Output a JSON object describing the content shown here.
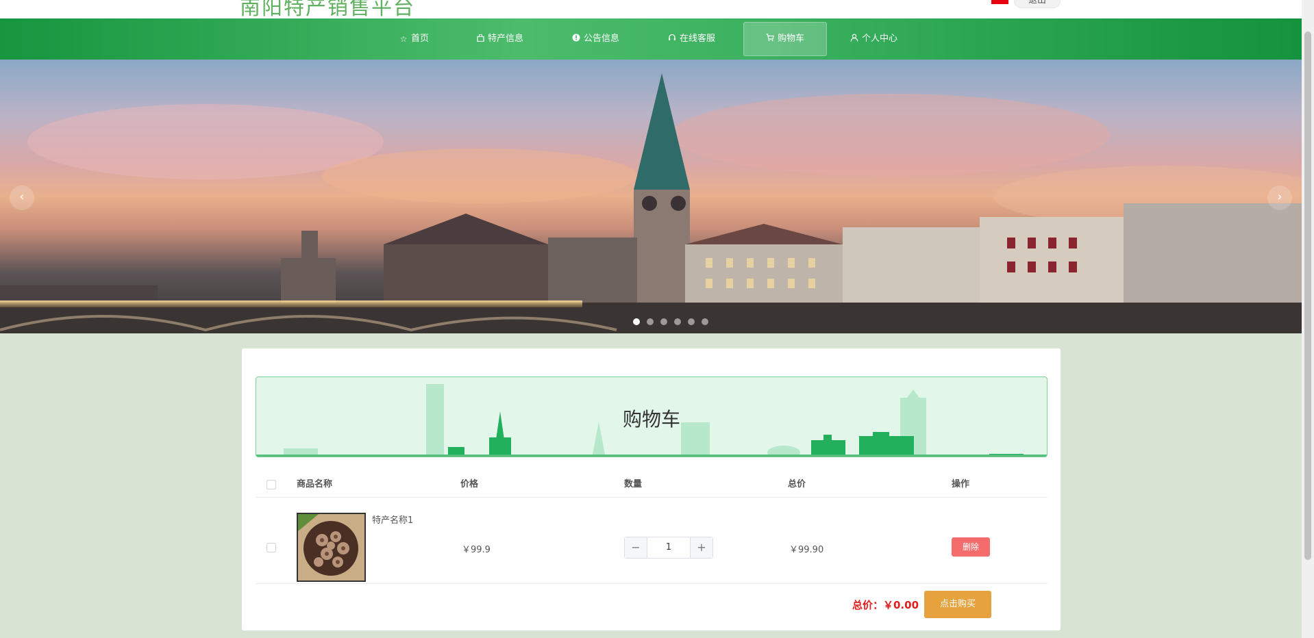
{
  "header": {
    "site_title": "南阳特产销售平台",
    "logout_label": "退出"
  },
  "nav": {
    "items": [
      {
        "label": "首页",
        "icon": "star-icon"
      },
      {
        "label": "特产信息",
        "icon": "bag-icon"
      },
      {
        "label": "公告信息",
        "icon": "info-icon"
      },
      {
        "label": "在线客服",
        "icon": "headset-icon"
      },
      {
        "label": "购物车",
        "icon": "cart-icon",
        "active": true
      },
      {
        "label": "个人中心",
        "icon": "user-icon"
      }
    ]
  },
  "banner": {
    "prev_label": "‹",
    "next_label": "›",
    "slide_count": 6,
    "active_slide": 1
  },
  "cart": {
    "title": "购物车",
    "columns": [
      "商品名称",
      "价格",
      "数量",
      "总价",
      "操作"
    ],
    "items": [
      {
        "name": "特产名称1",
        "price": "￥99.9",
        "quantity": "1",
        "subtotal": "￥99.90",
        "delete_label": "删除"
      }
    ],
    "total_label": "总价：￥0.00",
    "buy_label": "点击购买",
    "decrement_label": "−",
    "increment_label": "+"
  },
  "colors": {
    "nav": "#2fa452",
    "accent_delete": "#f56c6c",
    "accent_buy": "#e6a23c",
    "total_red": "#e21b1b"
  }
}
